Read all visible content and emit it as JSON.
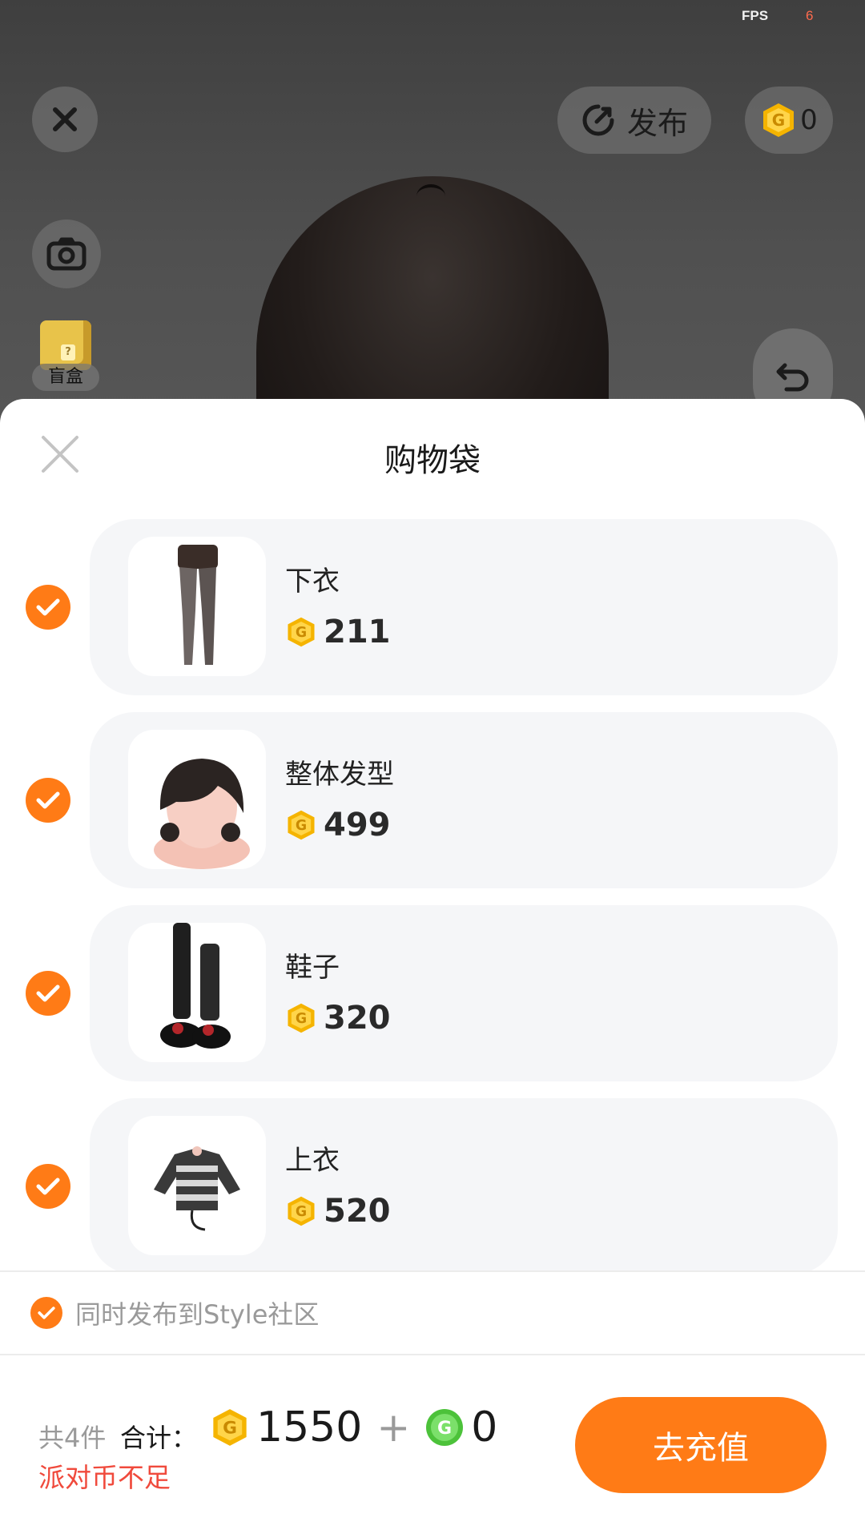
{
  "status": {
    "fps_label": "FPS",
    "fps_value": "6"
  },
  "top_bar": {
    "publish_label": "发布",
    "coin_balance": "0"
  },
  "side": {
    "blind_box_label": "盲盒"
  },
  "sheet": {
    "title": "购物袋",
    "items": [
      {
        "name": "下衣",
        "price": "211",
        "checked": true
      },
      {
        "name": "整体发型",
        "price": "499",
        "checked": true
      },
      {
        "name": "鞋子",
        "price": "320",
        "checked": true
      },
      {
        "name": "上衣",
        "price": "520",
        "checked": true
      }
    ],
    "publish_option": {
      "label": "同时发布到Style社区",
      "checked": true
    }
  },
  "footer": {
    "count_label": "共4件",
    "total_label": "合计：",
    "gold_total": "1550",
    "plus": "+",
    "green_total": "0",
    "warning": "派对币不足",
    "recharge_label": "去充值"
  },
  "colors": {
    "accent": "#ff7b16",
    "warning": "#f04a3c",
    "coin_gold": "#f5b400",
    "coin_green": "#4cc23a"
  }
}
